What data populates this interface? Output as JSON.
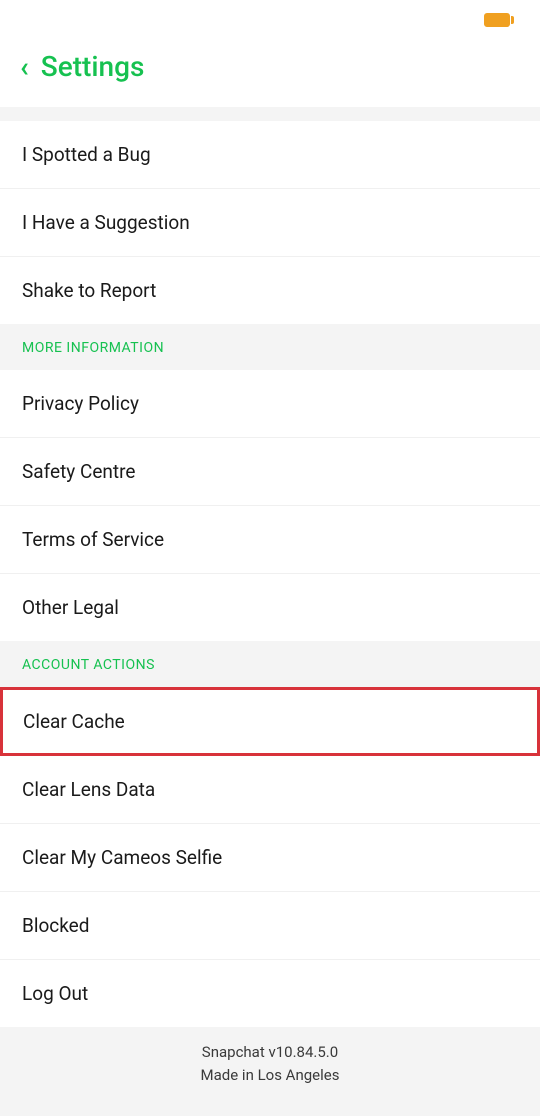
{
  "header": {
    "title": "Settings"
  },
  "feedback_section": {
    "items": [
      "I Spotted a Bug",
      "I Have a Suggestion",
      "Shake to Report"
    ]
  },
  "more_info_section": {
    "header": "MORE INFORMATION",
    "items": [
      "Privacy Policy",
      "Safety Centre",
      "Terms of Service",
      "Other Legal"
    ]
  },
  "account_actions_section": {
    "header": "ACCOUNT ACTIONS",
    "highlighted_item": "Clear Cache",
    "items": [
      "Clear Lens Data",
      "Clear My Cameos Selfie",
      "Blocked",
      "Log Out"
    ]
  },
  "footer": {
    "version": "Snapchat v10.84.5.0",
    "location": "Made in Los Angeles"
  }
}
